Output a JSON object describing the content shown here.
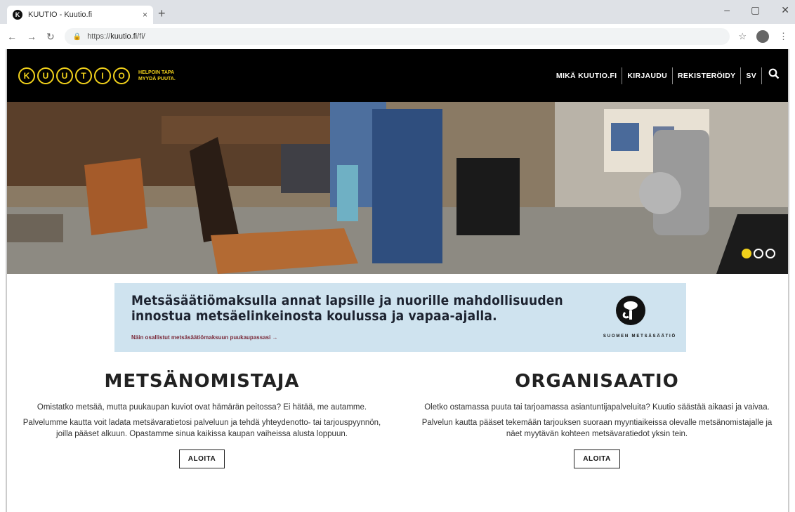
{
  "browser": {
    "tab_title": "KUUTIO - Kuutio.fi",
    "tab_close": "×",
    "new_tab": "+",
    "url_prefix": "https://",
    "url_host": "kuutio.fi",
    "url_path": "/fi/",
    "window_controls": [
      "–",
      "▢",
      "✕"
    ]
  },
  "header": {
    "logo_letters": [
      "K",
      "U",
      "U",
      "T",
      "I",
      "O"
    ],
    "tagline_1": "HELPOIN TAPA",
    "tagline_2": "MYYDÄ PUUTA.",
    "nav": [
      "MIKÄ KUUTIO.FI",
      "KIRJAUDU",
      "REKISTERÖIDY",
      "SV"
    ]
  },
  "hero": {
    "slide_count": 3,
    "active_slide": 1
  },
  "banner": {
    "line1": "Metsäsäätiömaksulla annat lapsille ja nuorille mahdollisuuden",
    "line2": "innostua metsäelinkeinosta koulussa ja vapaa-ajalla.",
    "link": "Näin osallistut metsäsäätiömaksuun puukaupassasi →",
    "org_name": "SUOMEN METSÄSÄÄTIÖ"
  },
  "left": {
    "title": "METSÄNOMISTAJA",
    "p1": "Omistatko metsää, mutta puukaupan kuviot ovat hämärän peitossa? Ei hätää, me autamme.",
    "p2": "Palvelumme kautta voit ladata metsävaratietosi palveluun ja tehdä yhteydenotto- tai tarjouspyynnön, joilla pääset alkuun. Opastamme sinua kaikissa kaupan vaiheissa alusta loppuun.",
    "button": "ALOITA"
  },
  "right": {
    "title": "ORGANISAATIO",
    "p1": "Oletko ostamassa puuta tai tarjoamassa asiantuntijapalveluita? Kuutio säästää aikaasi ja vaivaa.",
    "p2": "Palvelun kautta pääset tekemään tarjouksen suoraan myyntiaikeissa olevalle metsänomistajalle ja näet myytävän kohteen metsävaratiedot yksin tein.",
    "button": "ALOITA"
  },
  "colors": {
    "brand_yellow": "#f2d21b",
    "header_bg": "#000000",
    "banner_bg": "#cfe3ef"
  }
}
